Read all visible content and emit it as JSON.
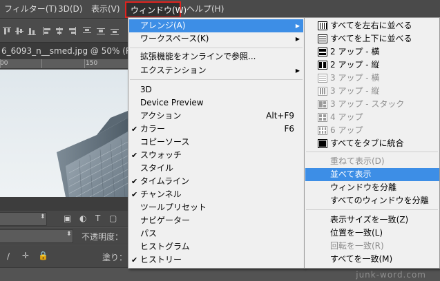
{
  "menubar": {
    "items": [
      {
        "label": "フィルター(T)"
      },
      {
        "label": "3D(D)"
      },
      {
        "label": "表示(V)"
      },
      {
        "label": "ウィンドウ(W)"
      },
      {
        "label": "ヘルプ(H)"
      }
    ]
  },
  "document": {
    "tab_title": "6_6093_n__smed.jpg @ 50% (RGB/",
    "ruler_labels": [
      "00",
      "150"
    ]
  },
  "panels": {
    "opacity_label": "不透明度：",
    "fill_label": "塗り："
  },
  "window_menu": {
    "items": [
      {
        "label": "アレンジ(A)",
        "submenu": true,
        "highlighted": true
      },
      {
        "label": "ワークスペース(K)",
        "submenu": true
      },
      {
        "label": "拡張機能をオンラインで参照..."
      },
      {
        "label": "エクステンション",
        "submenu": true
      },
      {
        "label": "3D"
      },
      {
        "label": "Device Preview"
      },
      {
        "label": "アクション",
        "shortcut": "Alt+F9"
      },
      {
        "label": "カラー",
        "shortcut": "F6",
        "checked": true
      },
      {
        "label": "コピーソース"
      },
      {
        "label": "スウォッチ",
        "checked": true
      },
      {
        "label": "スタイル"
      },
      {
        "label": "タイムライン",
        "checked": true
      },
      {
        "label": "チャンネル",
        "checked": true
      },
      {
        "label": "ツールプリセット"
      },
      {
        "label": "ナビゲーター"
      },
      {
        "label": "パス"
      },
      {
        "label": "ヒストグラム"
      },
      {
        "label": "ヒストリー",
        "checked": true
      }
    ]
  },
  "arrange_submenu": {
    "items": [
      {
        "label": "すべてを左右に並べる",
        "icon": "tile-vertical-icon"
      },
      {
        "label": "すべてを上下に並べる",
        "icon": "tile-horizontal-icon"
      },
      {
        "label": "2 アップ - 横",
        "icon": "two-up-horizontal-icon"
      },
      {
        "label": "2 アップ - 縦",
        "icon": "two-up-vertical-icon"
      },
      {
        "label": "3 アップ - 横",
        "icon": "three-up-horizontal-icon",
        "disabled": true
      },
      {
        "label": "3 アップ - 縦",
        "icon": "three-up-vertical-icon",
        "disabled": true
      },
      {
        "label": "3 アップ - スタック",
        "icon": "three-up-stacked-icon",
        "disabled": true
      },
      {
        "label": "4 アップ",
        "icon": "four-up-icon",
        "disabled": true
      },
      {
        "label": "6 アップ",
        "icon": "six-up-icon",
        "disabled": true
      },
      {
        "label": "すべてをタブに統合",
        "icon": "consolidate-tabs-icon"
      },
      {
        "label": "重ねて表示(D)",
        "disabled": true
      },
      {
        "label": "並べて表示",
        "highlighted": true
      },
      {
        "label": "ウィンドウを分離"
      },
      {
        "label": "すべてのウィンドウを分離"
      },
      {
        "label": "表示サイズを一致(Z)"
      },
      {
        "label": "位置を一致(L)"
      },
      {
        "label": "回転を一致(R)",
        "disabled": true
      },
      {
        "label": "すべてを一致(M)"
      }
    ]
  },
  "watermark": "junk-word.com",
  "colors": {
    "highlight": "#3d8ee6",
    "active_menu_border": "#e0231f",
    "menu_bg": "#f0f0f0",
    "chrome_bg": "#535353"
  }
}
